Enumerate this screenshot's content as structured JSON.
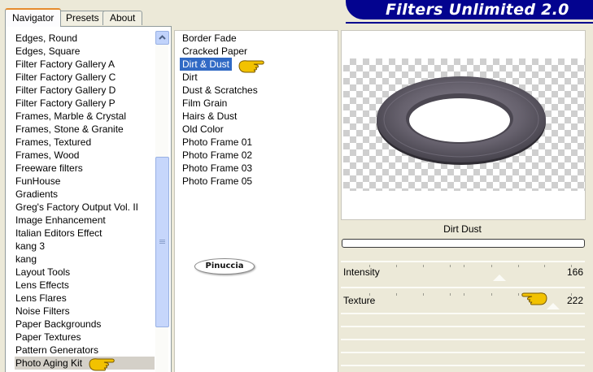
{
  "app": {
    "title": "Filters Unlimited 2.0"
  },
  "tabs": [
    {
      "label": "Navigator",
      "active": true
    },
    {
      "label": "Presets",
      "active": false
    },
    {
      "label": "About",
      "active": false
    }
  ],
  "categories": {
    "items": [
      "Edges, Round",
      "Edges, Square",
      "Filter Factory Gallery A",
      "Filter Factory Gallery C",
      "Filter Factory Gallery D",
      "Filter Factory Gallery P",
      "Frames, Marble & Crystal",
      "Frames, Stone & Granite",
      "Frames, Textured",
      "Frames, Wood",
      "Freeware filters",
      "FunHouse",
      "Gradients",
      "Greg's Factory Output Vol. II",
      "Image Enhancement",
      "Italian Editors Effect",
      "kang 3",
      "kang",
      "Layout Tools",
      "Lens Effects",
      "Lens Flares",
      "Noise Filters",
      "Paper Backgrounds",
      "Paper Textures",
      "Pattern Generators",
      "Photo Aging Kit"
    ],
    "selected": "Photo Aging Kit"
  },
  "filters": {
    "items": [
      "Border Fade",
      "Cracked Paper",
      "Dirt & Dust",
      "Dirt",
      "Dust & Scratches",
      "Film Grain",
      "Hairs & Dust",
      "Old Color",
      "Photo Frame 01",
      "Photo Frame 02",
      "Photo Frame 03",
      "Photo Frame 05"
    ],
    "selected": "Dirt & Dust"
  },
  "preview": {
    "filter_name": "Dirt  Dust"
  },
  "params": [
    {
      "label": "Intensity",
      "value": "166",
      "level": 166
    },
    {
      "label": "Texture",
      "value": "222",
      "level": 222
    }
  ],
  "watermark": {
    "text": "Pinuccia"
  },
  "colors": {
    "banner": "#03038f",
    "selection": "#316ac5",
    "dialog_bg": "#ece9d8",
    "pointer_hand": "#f2c200"
  },
  "icons": {
    "scroll_up": "chevron-up-icon",
    "pointer": "pointing-hand-icon"
  }
}
